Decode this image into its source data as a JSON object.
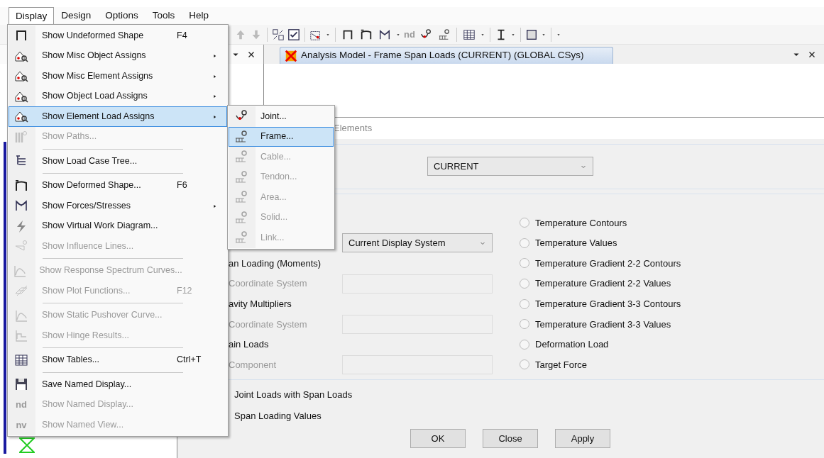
{
  "menubar": [
    {
      "label": "Display",
      "selected": true
    },
    {
      "label": "Design",
      "selected": false
    },
    {
      "label": "Options",
      "selected": false
    },
    {
      "label": "Tools",
      "selected": false
    },
    {
      "label": "Help",
      "selected": false
    }
  ],
  "toolbar": {
    "nd_label": "nd"
  },
  "document_tab": {
    "title": "Analysis Model - Frame Span Loads (CURRENT) (GLOBAL CSys)"
  },
  "display_menu": {
    "items": [
      {
        "kind": "item",
        "label": "Show Undeformed Shape",
        "shortcut": "F4",
        "submenu": false,
        "disabled": false,
        "selected": false
      },
      {
        "kind": "item",
        "label": "Show Misc Object Assigns",
        "submenu": true,
        "disabled": false,
        "selected": false
      },
      {
        "kind": "item",
        "label": "Show Misc Element Assigns",
        "submenu": true,
        "disabled": false,
        "selected": false
      },
      {
        "kind": "item",
        "label": "Show Object Load Assigns",
        "submenu": true,
        "disabled": false,
        "selected": false
      },
      {
        "kind": "item",
        "label": "Show Element Load Assigns",
        "submenu": true,
        "disabled": false,
        "selected": true
      },
      {
        "kind": "item",
        "label": "Show Paths...",
        "submenu": false,
        "disabled": true,
        "selected": false
      },
      {
        "kind": "separator"
      },
      {
        "kind": "item",
        "label": "Show Load Case Tree...",
        "submenu": false,
        "disabled": false,
        "selected": false
      },
      {
        "kind": "separator"
      },
      {
        "kind": "item",
        "label": "Show Deformed Shape...",
        "shortcut": "F6",
        "submenu": false,
        "disabled": false,
        "selected": false
      },
      {
        "kind": "item",
        "label": "Show Forces/Stresses",
        "submenu": true,
        "disabled": false,
        "selected": false
      },
      {
        "kind": "item",
        "label": "Show Virtual Work Diagram...",
        "submenu": false,
        "disabled": false,
        "selected": false
      },
      {
        "kind": "item",
        "label": "Show Influence Lines...",
        "submenu": false,
        "disabled": true,
        "selected": false
      },
      {
        "kind": "separator"
      },
      {
        "kind": "item",
        "label": "Show Response Spectrum Curves...",
        "submenu": false,
        "disabled": true,
        "selected": false
      },
      {
        "kind": "item",
        "label": "Show Plot Functions...",
        "shortcut": "F12",
        "submenu": false,
        "disabled": true,
        "selected": false
      },
      {
        "kind": "separator"
      },
      {
        "kind": "item",
        "label": "Show Static Pushover Curve...",
        "submenu": false,
        "disabled": true,
        "selected": false
      },
      {
        "kind": "item",
        "label": "Show Hinge Results...",
        "submenu": false,
        "disabled": true,
        "selected": false
      },
      {
        "kind": "separator"
      },
      {
        "kind": "item",
        "label": "Show Tables...",
        "shortcut": "Ctrl+T",
        "submenu": false,
        "disabled": false,
        "selected": false
      },
      {
        "kind": "separator"
      },
      {
        "kind": "item",
        "label": "Save Named Display...",
        "submenu": false,
        "disabled": false,
        "selected": false
      },
      {
        "kind": "item",
        "label": "Show Named Display...",
        "icon_text": "nd",
        "submenu": false,
        "disabled": true,
        "selected": false
      },
      {
        "kind": "item",
        "label": "Show Named View...",
        "icon_text": "nv",
        "submenu": false,
        "disabled": true,
        "selected": false
      }
    ]
  },
  "submenu": {
    "items": [
      {
        "label": "Joint...",
        "disabled": false,
        "selected": false
      },
      {
        "label": "Frame...",
        "disabled": false,
        "selected": true
      },
      {
        "label": "Cable...",
        "disabled": true,
        "selected": false
      },
      {
        "label": "Tendon...",
        "disabled": true,
        "selected": false
      },
      {
        "label": "Area...",
        "disabled": true,
        "selected": false
      },
      {
        "label": "Solid...",
        "disabled": true,
        "selected": false
      },
      {
        "label": "Link...",
        "disabled": true,
        "selected": false
      }
    ]
  },
  "dialog": {
    "header": "Elements",
    "load_case": {
      "value": "CURRENT"
    },
    "rows": [
      {
        "option": {
          "label": "Temperature Contours",
          "selected": false
        }
      },
      {
        "field": {
          "kind": "select",
          "value": "Current Display System"
        },
        "option": {
          "label": "Temperature Values",
          "selected": false
        }
      },
      {
        "label": "an Loading (Moments)",
        "disabled": false,
        "option": {
          "label": "Temperature Gradient 2-2 Contours",
          "selected": false
        }
      },
      {
        "label": "Coordinate System",
        "disabled": true,
        "field": {
          "kind": "input"
        },
        "option": {
          "label": "Temperature Gradient 2-2 Values",
          "selected": false
        }
      },
      {
        "label": "avity Multipliers",
        "disabled": false,
        "option": {
          "label": "Temperature Gradient 3-3 Contours",
          "selected": false
        }
      },
      {
        "label": "Coordinate System",
        "disabled": true,
        "field": {
          "kind": "input"
        },
        "option": {
          "label": "Temperature Gradient 3-3 Values",
          "selected": false
        }
      },
      {
        "label": "ain Loads",
        "disabled": false,
        "option": {
          "label": "Deformation Load",
          "selected": false
        }
      },
      {
        "label": "Component",
        "disabled": true,
        "field": {
          "kind": "input"
        },
        "option": {
          "label": "Target Force",
          "selected": false
        }
      }
    ],
    "checks": [
      "Joint Loads with Span Loads",
      "Span Loading Values"
    ],
    "buttons": [
      "OK",
      "Close",
      "Apply"
    ]
  }
}
